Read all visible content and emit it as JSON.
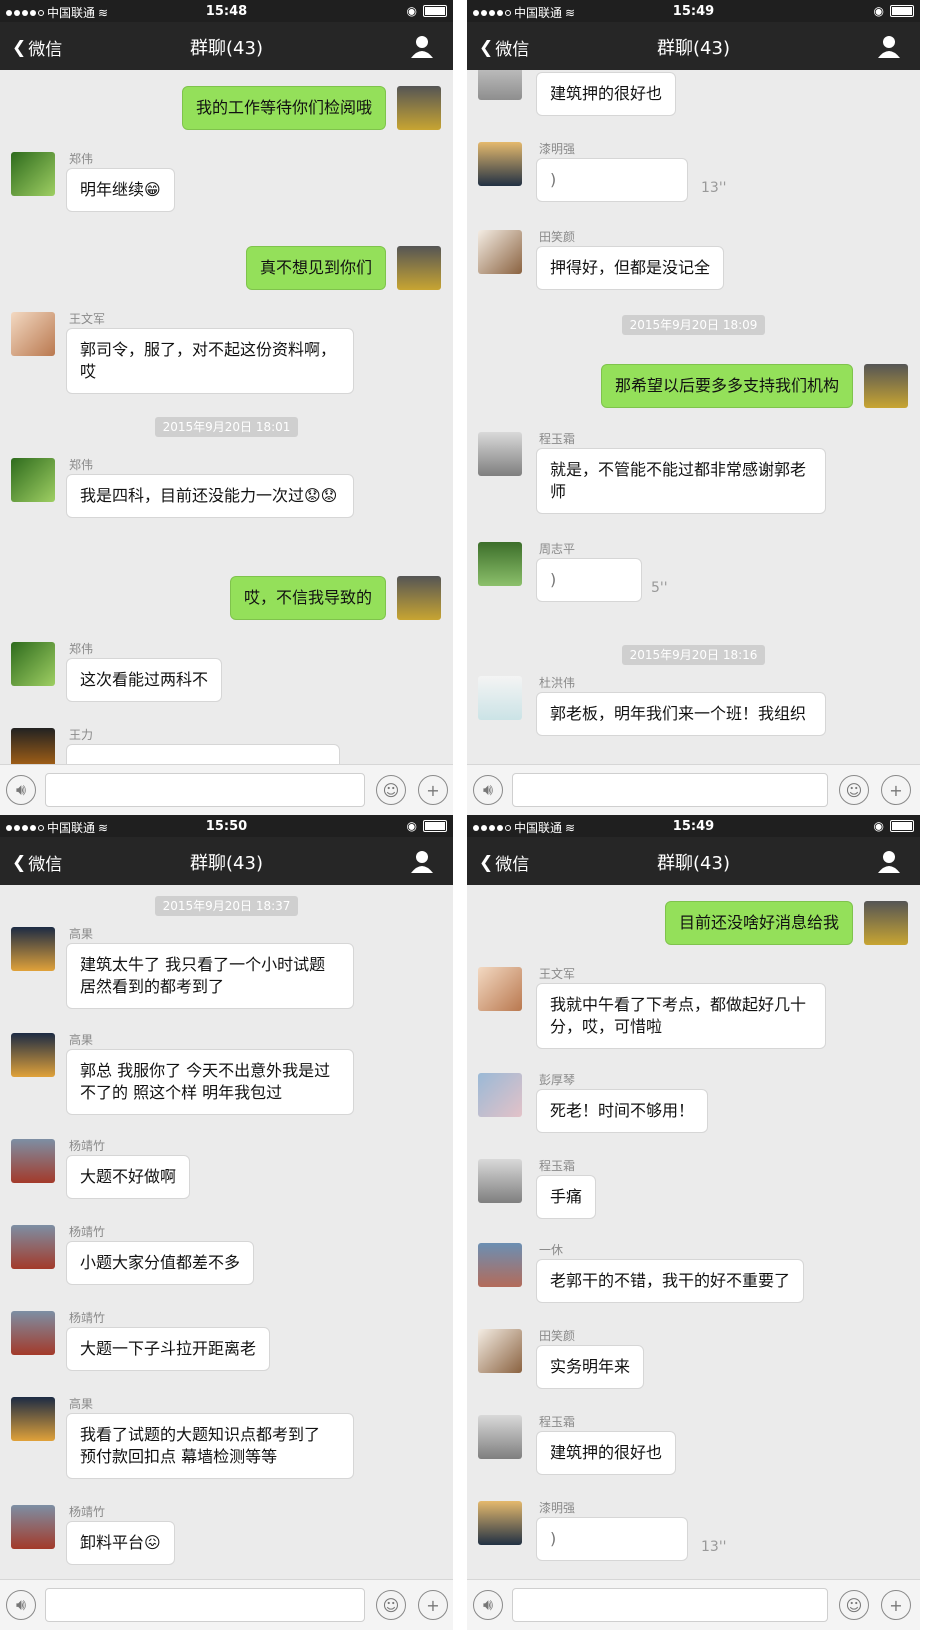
{
  "common": {
    "carrier": "中国联通",
    "back": "微信",
    "title": "群聊(43)"
  },
  "panels": [
    {
      "time": "15:48"
    },
    {
      "time": "15:49"
    },
    {
      "time": "15:50"
    },
    {
      "time": "15:49"
    }
  ],
  "p1": {
    "m1": "我的工作等待你们检阅哦",
    "n2": "郑伟",
    "m2": "明年继续😁",
    "m3": "真不想见到你们",
    "n4": "王文军",
    "m4": "郭司令，服了，对不起这份资料啊，哎",
    "ts1": "2015年9月20日 18:01",
    "n5": "郑伟",
    "m5": "我是四科，目前还没能力一次过😟😟",
    "m6": "哎，不信我导致的",
    "n7": "郑伟",
    "m7": "这次看能过两科不",
    "n8": "王力"
  },
  "p2": {
    "m1": "建筑押的很好也",
    "n2": "漆明强",
    "d2": "13''",
    "n3": "田笑颜",
    "m3": "押得好，但都是没记全",
    "ts1": "2015年9月20日 18:09",
    "m4": "那希望以后要多多支持我们机构",
    "n5": "程玉霜",
    "m5": "就是，不管能不能过都非常感谢郭老师",
    "n6": "周志平",
    "d6": "5''",
    "ts2": "2015年9月20日 18:16",
    "n7": "杜洪伟",
    "m7": "郭老板，明年我们来一个班！我组织"
  },
  "p3": {
    "ts1": "2015年9月20日 18:37",
    "n1": "高果",
    "m1": "建筑太牛了 我只看了一个小时试题 居然看到的都考到了",
    "n2": "高果",
    "m2": "郭总 我服你了 今天不出意外我是过不了的 照这个样 明年我包过",
    "n3": "杨靖竹",
    "m3": "大题不好做啊",
    "n4": "杨靖竹",
    "m4": "小题大家分值都差不多",
    "n5": "杨靖竹",
    "m5": "大题一下子斗拉开距离老",
    "n6": "高果",
    "m6": "我看了试题的大题知识点都考到了 预付款回扣点 幕墙检测等等",
    "n7": "杨靖竹",
    "m7": "卸料平台😖"
  },
  "p4": {
    "m1": "目前还没啥好消息给我",
    "n2": "王文军",
    "m2": "我就中午看了下考点，都做起好几十分，哎，可惜啦",
    "n3": "彭厚琴",
    "m3": "死老！时间不够用！",
    "n4": "程玉霜",
    "m4": "手痛",
    "n5": "一休",
    "m5": "老郭干的不错，我干的好不重要了",
    "n6": "田笑颜",
    "m6": "实务明年来",
    "n7": "程玉霜",
    "m7": "建筑押的很好也",
    "n8": "漆明强",
    "d8": "13''"
  },
  "colors": {
    "accent": "#94e05a",
    "navbar": "#262626",
    "background": "#ebebeb"
  }
}
